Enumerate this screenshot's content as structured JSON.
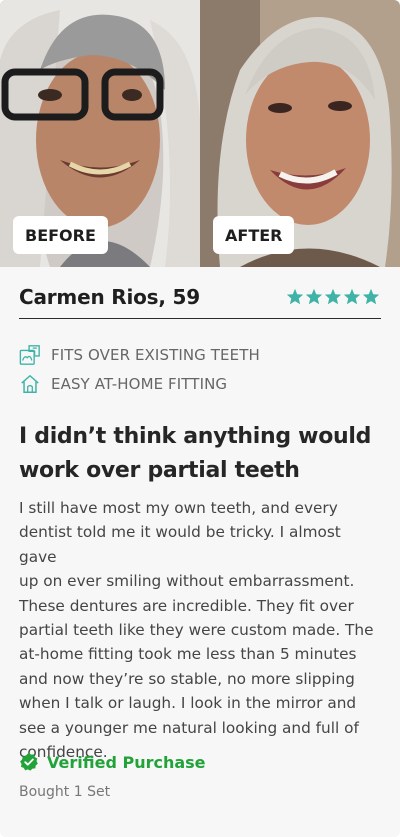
{
  "photos": {
    "before_label": "BEFORE",
    "after_label": "AFTER"
  },
  "reviewer": {
    "name": "Carmen Rios, 59",
    "rating": 5,
    "rating_max": 5,
    "star_color": "#3fb3a7"
  },
  "features": [
    {
      "icon": "puzzle-teeth-icon",
      "label": "FITS OVER EXISTING TEETH"
    },
    {
      "icon": "home-icon",
      "label": "EASY AT-HOME FITTING"
    }
  ],
  "review": {
    "headline_lines": [
      "I didn’t think anything would",
      "work over partial teeth"
    ],
    "body_lines": [
      "I still have most my own teeth, and every",
      "dentist told me it would be tricky. I almost gave",
      "up on ever smiling without embarrassment.",
      "These dentures are incredible. They fit over",
      "partial teeth like they were custom made. The",
      "at-home fitting took me less than 5 minutes",
      "and now they’re so stable, no more slipping",
      "when I talk or laugh. I look in the mirror and",
      "see a younger me natural looking and full of",
      "confidence."
    ]
  },
  "verified": {
    "icon": "verified-check-icon",
    "label": "Verified Purchase",
    "color": "#22a33a"
  },
  "purchase_note": "Bought 1 Set"
}
